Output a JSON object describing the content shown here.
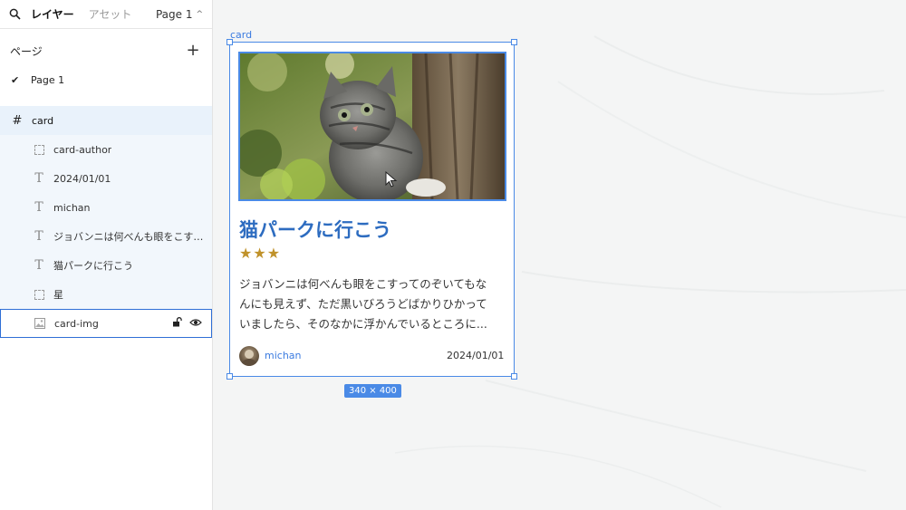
{
  "topbar": {
    "tab_layers": "レイヤー",
    "tab_assets": "アセット",
    "page_selector": "Page 1",
    "page_chevron": "^"
  },
  "pages": {
    "title": "ページ",
    "add_label": "+",
    "items": [
      {
        "label": "Page 1",
        "check": "✔"
      }
    ]
  },
  "layers": {
    "root": {
      "label": "card",
      "icon": "frame-hash-icon",
      "glyph": "#"
    },
    "children": [
      {
        "label": "card-author",
        "icon": "frame-dashed-icon"
      },
      {
        "label": "2024/01/01",
        "icon": "text-icon",
        "glyph": "T"
      },
      {
        "label": "michan",
        "icon": "text-icon",
        "glyph": "T"
      },
      {
        "label": "ジョバンニは何べんも眼をこす…",
        "icon": "text-icon",
        "glyph": "T"
      },
      {
        "label": "猫パークに行こう",
        "icon": "text-icon",
        "glyph": "T"
      },
      {
        "label": "星",
        "icon": "frame-dashed-icon"
      },
      {
        "label": "card-img",
        "icon": "image-icon"
      }
    ]
  },
  "canvas": {
    "frame_label": "card",
    "card": {
      "title": "猫パークに行こう",
      "stars": "★★★",
      "body_lines": [
        "ジョバンニは何べんも眼をこすってのぞいてもな",
        "んにも見えず、ただ黒いびろうどばかりひかって",
        "いましたら、そのなかに浮かんでいるところに..."
      ],
      "author": "michan",
      "date": "2024/01/01"
    },
    "size_badge": "340 × 400"
  },
  "colors": {
    "accent": "#4a8ae6",
    "title": "#2d6cc0",
    "star": "#c0922b",
    "layer_root_bg": "#e9f2fb"
  }
}
